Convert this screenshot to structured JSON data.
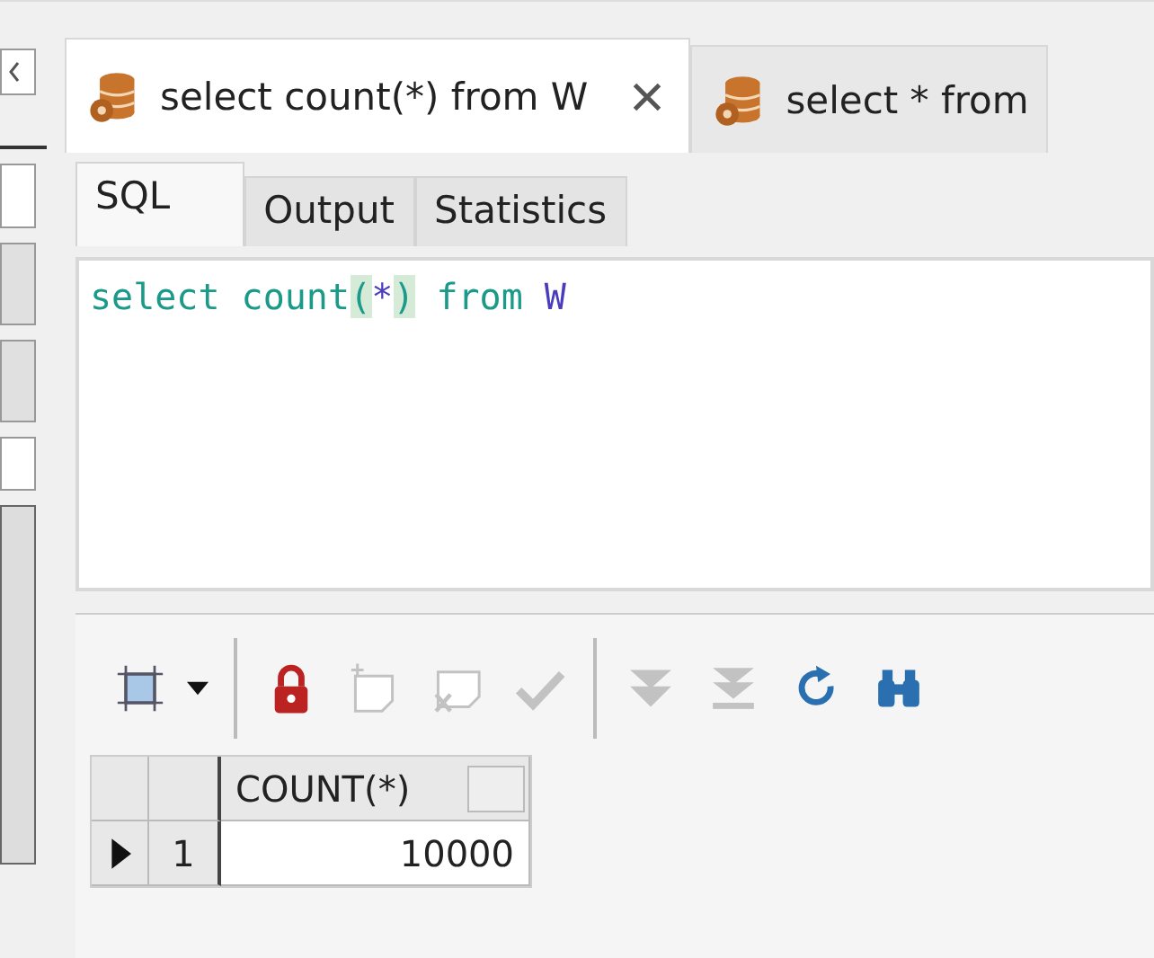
{
  "doc_tabs": [
    {
      "label": "select count(*) from W",
      "selected": true,
      "closable": true
    },
    {
      "label": "select * from",
      "selected": false,
      "closable": false
    }
  ],
  "sub_tabs": [
    {
      "label": "SQL",
      "selected": true
    },
    {
      "label": "Output",
      "selected": false
    },
    {
      "label": "Statistics",
      "selected": false
    }
  ],
  "editor": {
    "tokens": [
      {
        "text": "select ",
        "kind": "keyword"
      },
      {
        "text": "count",
        "kind": "keyword"
      },
      {
        "text": "(",
        "kind": "bracket"
      },
      {
        "text": "*",
        "kind": "identifier"
      },
      {
        "text": ")",
        "kind": "bracket"
      },
      {
        "text": " from ",
        "kind": "keyword"
      },
      {
        "text": "W",
        "kind": "identifier"
      }
    ]
  },
  "toolbar": [
    {
      "kind": "select",
      "disabled": false
    },
    {
      "kind": "separator"
    },
    {
      "kind": "lock",
      "disabled": false
    },
    {
      "kind": "new-record",
      "disabled": true
    },
    {
      "kind": "delete-record",
      "disabled": true
    },
    {
      "kind": "post",
      "disabled": true
    },
    {
      "kind": "separator"
    },
    {
      "kind": "fetch-next",
      "disabled": true
    },
    {
      "kind": "fetch-last",
      "disabled": true
    },
    {
      "kind": "refresh",
      "disabled": false
    },
    {
      "kind": "find",
      "disabled": false
    }
  ],
  "grid": {
    "columns": [
      "COUNT(*)"
    ],
    "rows": [
      {
        "number": "1",
        "current": true,
        "cells": [
          "10000"
        ]
      }
    ]
  }
}
